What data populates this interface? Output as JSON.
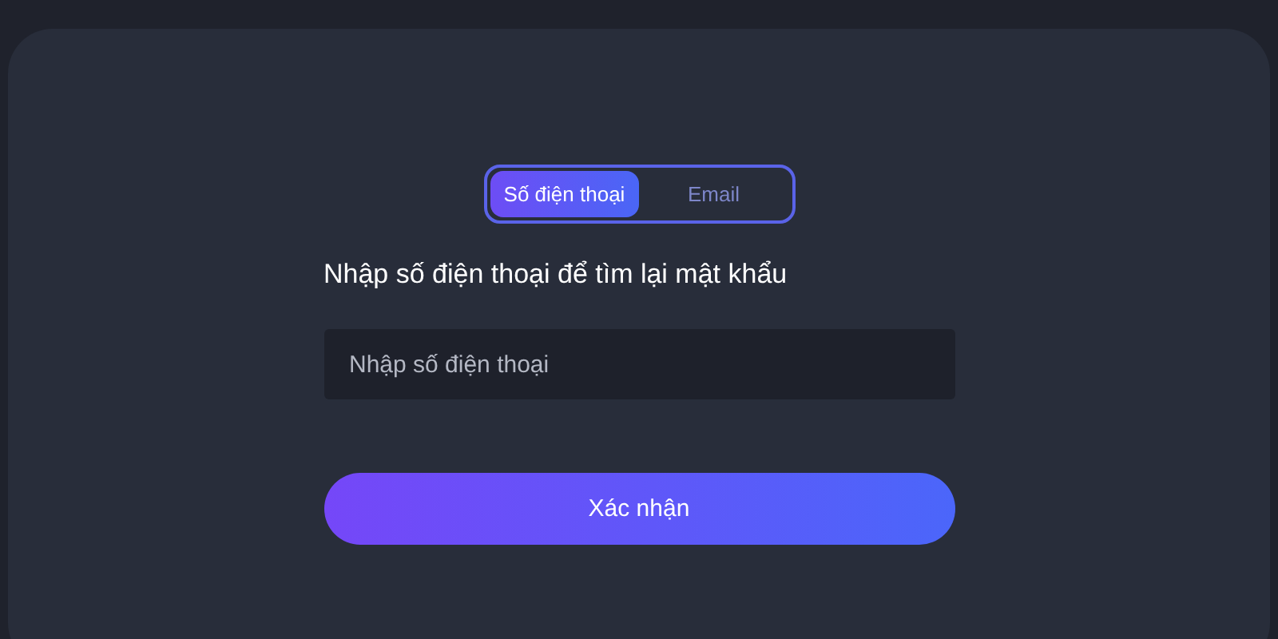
{
  "tabs": [
    {
      "label": "Số điện thoại",
      "selected": true
    },
    {
      "label": "Email",
      "selected": false
    }
  ],
  "heading": "Nhập số điện thoại để tìm lại mật khẩu",
  "phone_field": {
    "placeholder": "Nhập số điện thoại"
  },
  "submit_button": "Xác nhận"
}
